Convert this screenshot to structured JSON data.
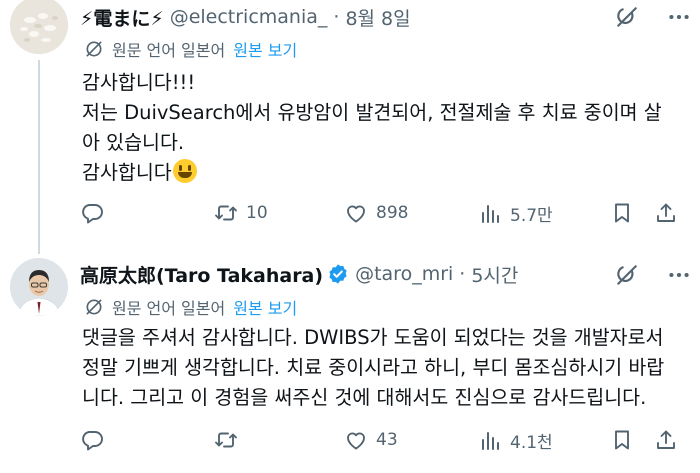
{
  "colors": {
    "text": "#0f1419",
    "muted": "#536471",
    "link": "#1d9bf0",
    "verified": "#1d9bf0",
    "divider": "#cfd9de"
  },
  "post1": {
    "name": "⚡電まに⚡",
    "handle": "@electricmania_",
    "separator": "·",
    "time": "8월 8일",
    "translate_label": "원문 언어 일본어",
    "show_original": "원본 보기",
    "lines": [
      "감사합니다!!!",
      "저는 DuivSearch에서 유방암이 발견되어, 전절제술 후 치료 중이며 살",
      "아 있습니다.",
      "감사합니다"
    ],
    "emoji": "grinning-face",
    "stats": {
      "replies": "",
      "reposts": "10",
      "likes": "898",
      "views": "5.7만"
    }
  },
  "post2": {
    "name": "高原太郎(Taro Takahara)",
    "handle": "@taro_mri",
    "separator": "·",
    "time": "5시간",
    "translate_label": "원문 언어 일본어",
    "show_original": "원본 보기",
    "lines": [
      "댓글을 주셔서 감사합니다. DWIBS가 도움이 되었다는 것을 개발자로서",
      "정말 기쁘게 생각합니다. 치료 중이시라고 하니, 부디 몸조심하시기 바랍",
      "니다. 그리고 이 경험을 써주신 것에 대해서도 진심으로 감사드립니다."
    ],
    "stats": {
      "replies": "",
      "reposts": "",
      "likes": "43",
      "views": "4.1천"
    }
  },
  "icons": {
    "grok": "grok-icon",
    "more": "more-icon",
    "translate": "translate-icon",
    "reply": "reply-icon",
    "repost": "repost-icon",
    "like": "like-icon",
    "views": "views-icon",
    "bookmark": "bookmark-icon",
    "share": "share-icon",
    "verified": "verified-badge-icon"
  }
}
